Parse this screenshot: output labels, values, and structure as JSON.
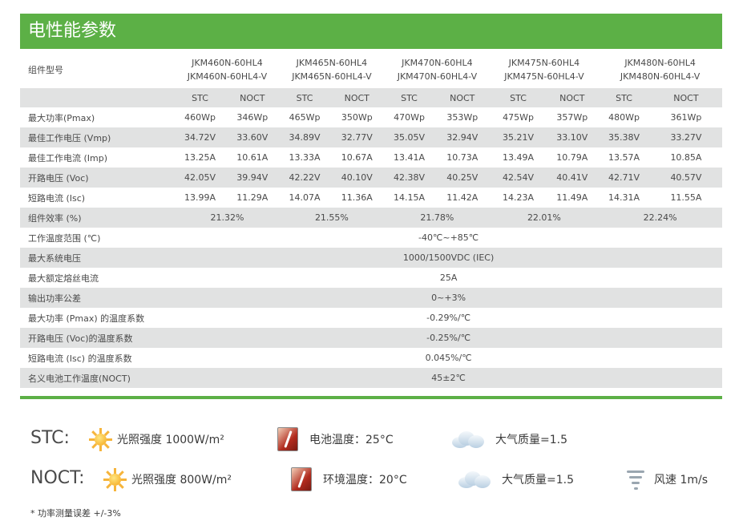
{
  "section_title": "电性能参数",
  "model_label": "组件型号",
  "models": [
    {
      "line1": "JKM460N-60HL4",
      "line2": "JKM460N-60HL4-V"
    },
    {
      "line1": "JKM465N-60HL4",
      "line2": "JKM465N-60HL4-V"
    },
    {
      "line1": "JKM470N-60HL4",
      "line2": "JKM470N-60HL4-V"
    },
    {
      "line1": "JKM475N-60HL4",
      "line2": "JKM475N-60HL4-V"
    },
    {
      "line1": "JKM480N-60HL4",
      "line2": "JKM480N-60HL4-V"
    }
  ],
  "sub_headers": [
    "STC",
    "NOCT",
    "STC",
    "NOCT",
    "STC",
    "NOCT",
    "STC",
    "NOCT",
    "STC",
    "NOCT"
  ],
  "pair_rows": [
    {
      "label": "最大功率(Pmax)",
      "values": [
        "460Wp",
        "346Wp",
        "465Wp",
        "350Wp",
        "470Wp",
        "353Wp",
        "475Wp",
        "357Wp",
        "480Wp",
        "361Wp"
      ]
    },
    {
      "label": "最佳工作电压 (Vmp)",
      "values": [
        "34.72V",
        "33.60V",
        "34.89V",
        "32.77V",
        "35.05V",
        "32.94V",
        "35.21V",
        "33.10V",
        "35.38V",
        "33.27V"
      ]
    },
    {
      "label": "最佳工作电流 (Imp)",
      "values": [
        "13.25A",
        "10.61A",
        "13.33A",
        "10.67A",
        "13.41A",
        "10.73A",
        "13.49A",
        "10.79A",
        "13.57A",
        "10.85A"
      ]
    },
    {
      "label": "开路电压 (Voc)",
      "values": [
        "42.05V",
        "39.94V",
        "42.22V",
        "40.10V",
        "42.38V",
        "40.25V",
        "42.54V",
        "40.41V",
        "42.71V",
        "40.57V"
      ]
    },
    {
      "label": "短路电流 (Isc)",
      "values": [
        "13.99A",
        "11.29A",
        "14.07A",
        "11.36A",
        "14.15A",
        "11.42A",
        "14.23A",
        "11.49A",
        "14.31A",
        "11.55A"
      ]
    }
  ],
  "efficiency": {
    "label": "组件效率 (%)",
    "values": [
      "21.32%",
      "21.55%",
      "21.78%",
      "22.01%",
      "22.24%"
    ]
  },
  "common_rows": [
    {
      "label": "工作温度范围 (℃)",
      "value": "-40℃~+85℃"
    },
    {
      "label": "最大系统电压",
      "value": "1000/1500VDC (IEC)"
    },
    {
      "label": "最大额定熔丝电流",
      "value": "25A"
    },
    {
      "label": "输出功率公差",
      "value": "0~+3%"
    },
    {
      "label": "最大功率 (Pmax) 的温度系数",
      "value": "-0.29%/℃"
    },
    {
      "label": "开路电压 (Voc)的温度系数",
      "value": "-0.25%/℃"
    },
    {
      "label": "短路电流 (Isc) 的温度系数",
      "value": "0.045%/℃"
    },
    {
      "label": "名义电池工作温度(NOCT)",
      "value": "45±2℃"
    }
  ],
  "conditions": {
    "stc": {
      "title": "STC:",
      "irradiance": "光照强度 1000W/m²",
      "cell_temp": "电池温度：25°C",
      "air_mass": "大气质量=1.5"
    },
    "noct": {
      "title": "NOCT:",
      "irradiance": "光照强度 800W/m²",
      "ambient_temp": "环境温度：20°C",
      "air_mass": "大气质量=1.5",
      "wind": "风速 1m/s"
    }
  },
  "footnote": "* 功率测量误差 +/-3%",
  "colors": {
    "brand_green": "#5cb046",
    "row_shade": "#e1e2e2"
  },
  "icons": [
    "sun-icon",
    "thermometer-icon",
    "cloud-icon",
    "wind-icon"
  ]
}
